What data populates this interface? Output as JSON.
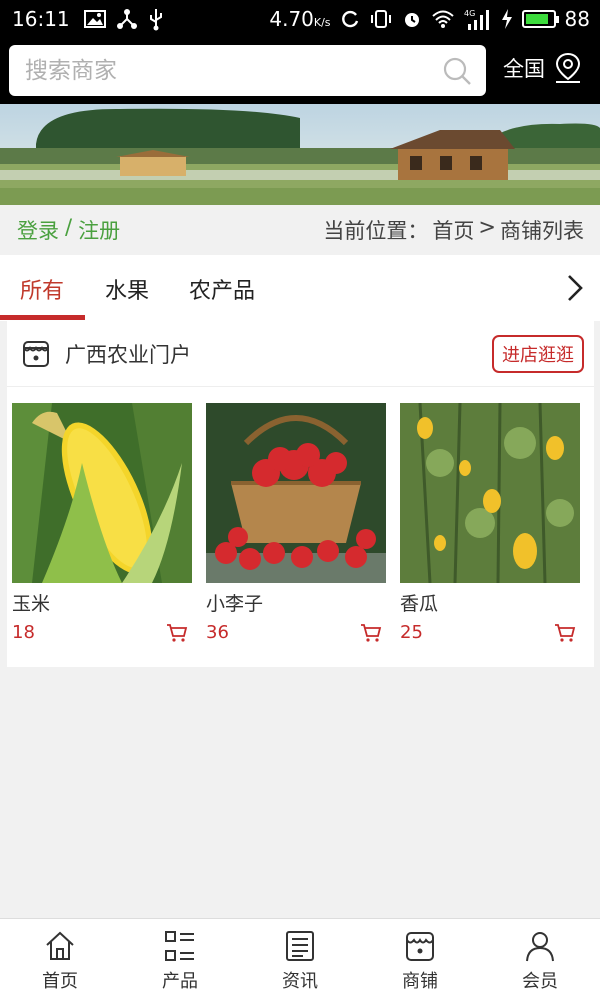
{
  "status_bar": {
    "time": "16:11",
    "speed": "4.70",
    "speed_unit": "K/s",
    "network": "4G",
    "battery": "88",
    "battery_level": 0.88
  },
  "search": {
    "placeholder": "搜索商家",
    "region_label": "全国"
  },
  "auth": {
    "login": "登录",
    "separator": "/",
    "register": "注册"
  },
  "breadcrumb": {
    "prefix": "当前位置：",
    "home": "首页",
    "arrow": ">",
    "current": "商铺列表"
  },
  "tabs": [
    {
      "label": "所有",
      "active": true
    },
    {
      "label": "水果",
      "active": false
    },
    {
      "label": "农产品",
      "active": false
    }
  ],
  "shop": {
    "name": "广西农业门户",
    "visit_label": "进店逛逛",
    "products": [
      {
        "name": "玉米",
        "price": "18",
        "image": "corn"
      },
      {
        "name": "小李子",
        "price": "36",
        "image": "plums-basket"
      },
      {
        "name": "香瓜",
        "price": "25",
        "image": "melons-on-vine"
      }
    ]
  },
  "bottom_nav": [
    {
      "label": "首页",
      "icon": "home-icon"
    },
    {
      "label": "产品",
      "icon": "list-icon"
    },
    {
      "label": "资讯",
      "icon": "news-icon"
    },
    {
      "label": "商铺",
      "icon": "store-icon"
    },
    {
      "label": "会员",
      "icon": "user-icon"
    }
  ],
  "colors": {
    "accent_red": "#c62b2b",
    "auth_green": "#4aa03f",
    "header_bg": "#000000"
  }
}
